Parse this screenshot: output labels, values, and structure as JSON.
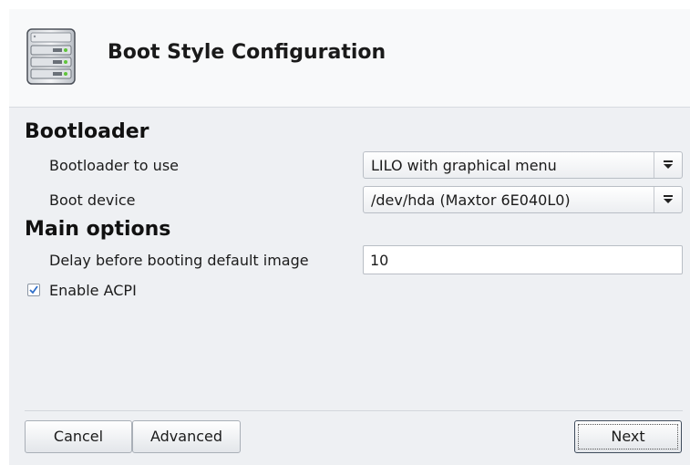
{
  "header": {
    "title": "Boot Style Configuration",
    "icon": "server-drives-icon"
  },
  "bootloader_section": {
    "title": "Bootloader",
    "bootloader_label": "Bootloader to use",
    "bootloader_value": "LILO with graphical menu",
    "boot_device_label": "Boot device",
    "boot_device_value": "/dev/hda (Maxtor 6E040L0)"
  },
  "main_options_section": {
    "title": "Main options",
    "delay_label": "Delay before booting default image",
    "delay_value": "10",
    "acpi_label": "Enable ACPI",
    "acpi_checked": true
  },
  "buttons": {
    "cancel": "Cancel",
    "advanced": "Advanced",
    "next": "Next"
  },
  "colors": {
    "background": "#eef0f3",
    "header_background": "#f8f9fa",
    "checkmark": "#2f6fc9"
  }
}
